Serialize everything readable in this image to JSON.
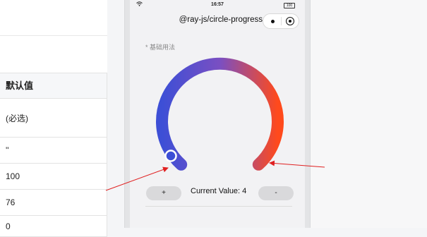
{
  "table": {
    "header": "默认值",
    "rows": [
      "(必选)",
      "''",
      "100",
      "76",
      "0"
    ]
  },
  "status_bar": {
    "time": "16:57",
    "battery": "100"
  },
  "nav": {
    "title": "@ray-js/circle-progress"
  },
  "section": {
    "label": "* 基础用法"
  },
  "gauge": {
    "value": 4,
    "max": 100,
    "gradient_start": "#3d4fd6",
    "gradient_mid": "#7a4fc2",
    "gradient_end": "#ff4a1c"
  },
  "controls": {
    "plus_label": "+",
    "current_text": "Current Value: 4",
    "minus_label": "-"
  },
  "colors": {
    "arrow": "#e02020"
  }
}
